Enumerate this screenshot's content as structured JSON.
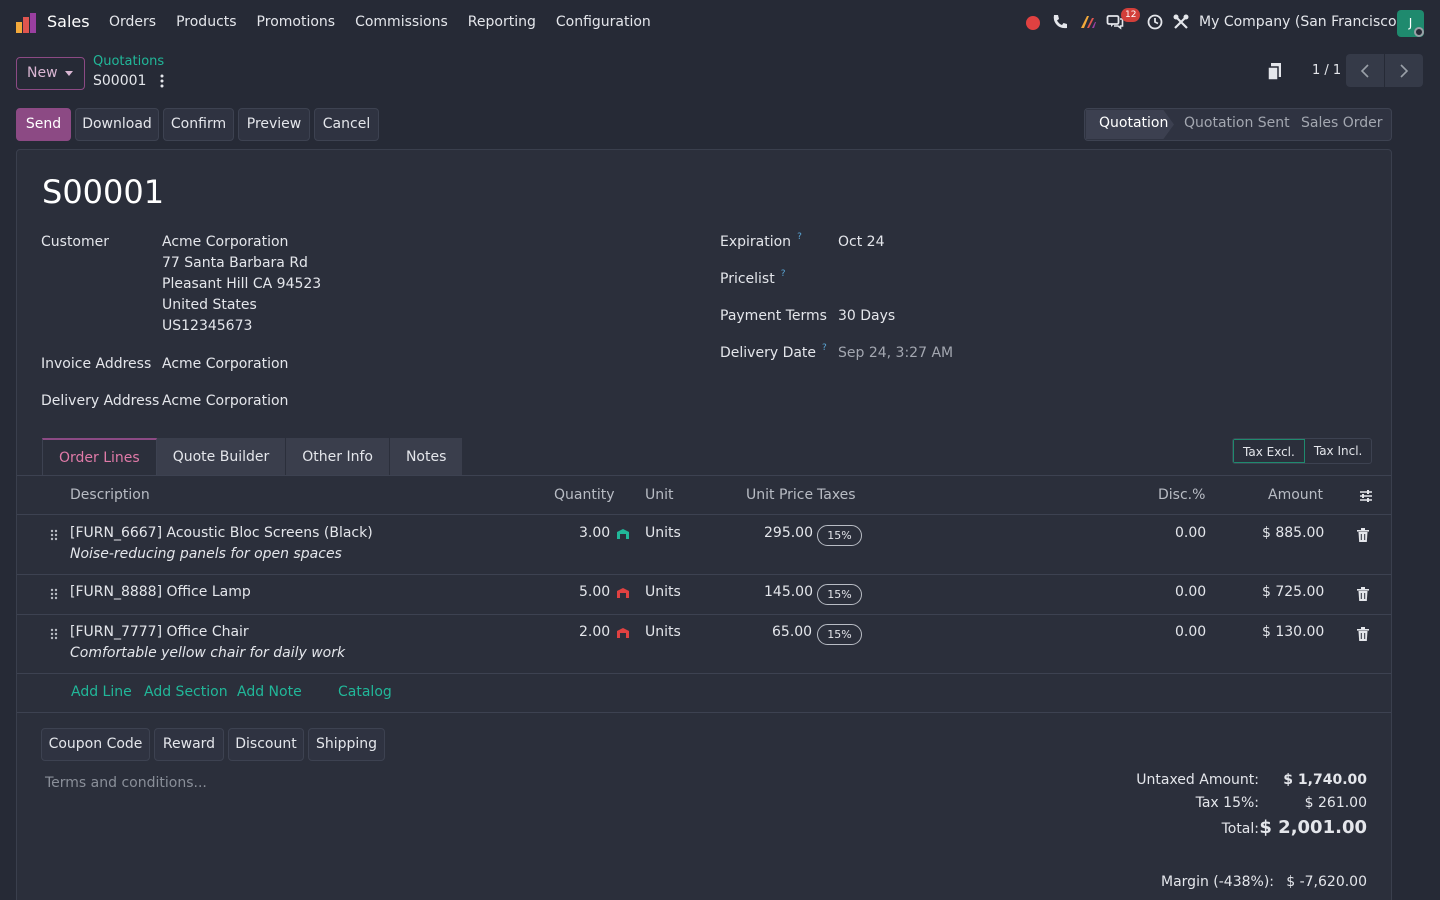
{
  "app": {
    "name": "Sales"
  },
  "menu": [
    "Orders",
    "Products",
    "Promotions",
    "Commissions",
    "Reporting",
    "Configuration"
  ],
  "systray": {
    "message_count": "12",
    "company": "My Company (San Francisco)",
    "avatar_letter": "J"
  },
  "control": {
    "new_label": "New",
    "breadcrumb_parent": "Quotations",
    "breadcrumb_current": "S00001",
    "pager": "1 / 1"
  },
  "actions": [
    "Send",
    "Download",
    "Confirm",
    "Preview",
    "Cancel"
  ],
  "statusbar": {
    "items": [
      "Quotation",
      "Quotation Sent",
      "Sales Order"
    ],
    "active": "Quotation"
  },
  "form": {
    "title": "S00001",
    "customer_label": "Customer",
    "customer": [
      "Acme Corporation",
      "77 Santa Barbara Rd",
      "Pleasant Hill CA 94523",
      "United States",
      "US12345673"
    ],
    "invoice_address_label": "Invoice Address",
    "invoice_address": "Acme Corporation",
    "delivery_address_label": "Delivery Address",
    "delivery_address": "Acme Corporation",
    "expiration_label": "Expiration",
    "expiration": "Oct 24",
    "pricelist_label": "Pricelist",
    "payment_terms_label": "Payment Terms",
    "payment_terms": "30 Days",
    "delivery_date_label": "Delivery Date",
    "delivery_date": "Sep 24, 3:27 AM",
    "help_mark": "?"
  },
  "tabs": [
    "Order Lines",
    "Quote Builder",
    "Other Info",
    "Notes"
  ],
  "tax_toggle": [
    "Tax Excl.",
    "Tax Incl."
  ],
  "table": {
    "headers": {
      "description": "Description",
      "quantity": "Quantity",
      "unit": "Unit",
      "unit_price": "Unit Price",
      "taxes": "Taxes",
      "disc": "Disc.%",
      "amount": "Amount"
    },
    "rows": [
      {
        "product": "[FURN_6667] Acoustic Bloc Screens (Black)",
        "note": "Noise-reducing panels for open spaces",
        "quantity": "3.00",
        "forecast": "ok",
        "unit": "Units",
        "unit_price": "295.00",
        "tax": "15%",
        "disc": "0.00",
        "amount": "$ 885.00"
      },
      {
        "product": "[FURN_8888] Office Lamp",
        "note": "",
        "quantity": "5.00",
        "forecast": "late",
        "unit": "Units",
        "unit_price": "145.00",
        "tax": "15%",
        "disc": "0.00",
        "amount": "$ 725.00"
      },
      {
        "product": "[FURN_7777] Office Chair",
        "note": "Comfortable yellow chair for daily work",
        "quantity": "2.00",
        "forecast": "late",
        "unit": "Units",
        "unit_price": "65.00",
        "tax": "15%",
        "disc": "0.00",
        "amount": "$ 130.00"
      }
    ],
    "add_links": [
      "Add Line",
      "Add Section",
      "Add Note",
      "Catalog"
    ]
  },
  "promo_buttons": [
    "Coupon Code",
    "Reward",
    "Discount",
    "Shipping"
  ],
  "terms_placeholder": "Terms and conditions...",
  "totals": {
    "untaxed_label": "Untaxed Amount:",
    "untaxed": "$ 1,740.00",
    "tax_label": "Tax 15%:",
    "tax": "$ 261.00",
    "total_label": "Total:",
    "total": "$ 2,001.00",
    "margin_label": "Margin (-438%):",
    "margin": "$ -7,620.00"
  },
  "colors": {
    "accent": "#8c4a84",
    "link": "#21b799",
    "ok": "#21b799",
    "late": "#e04141"
  }
}
